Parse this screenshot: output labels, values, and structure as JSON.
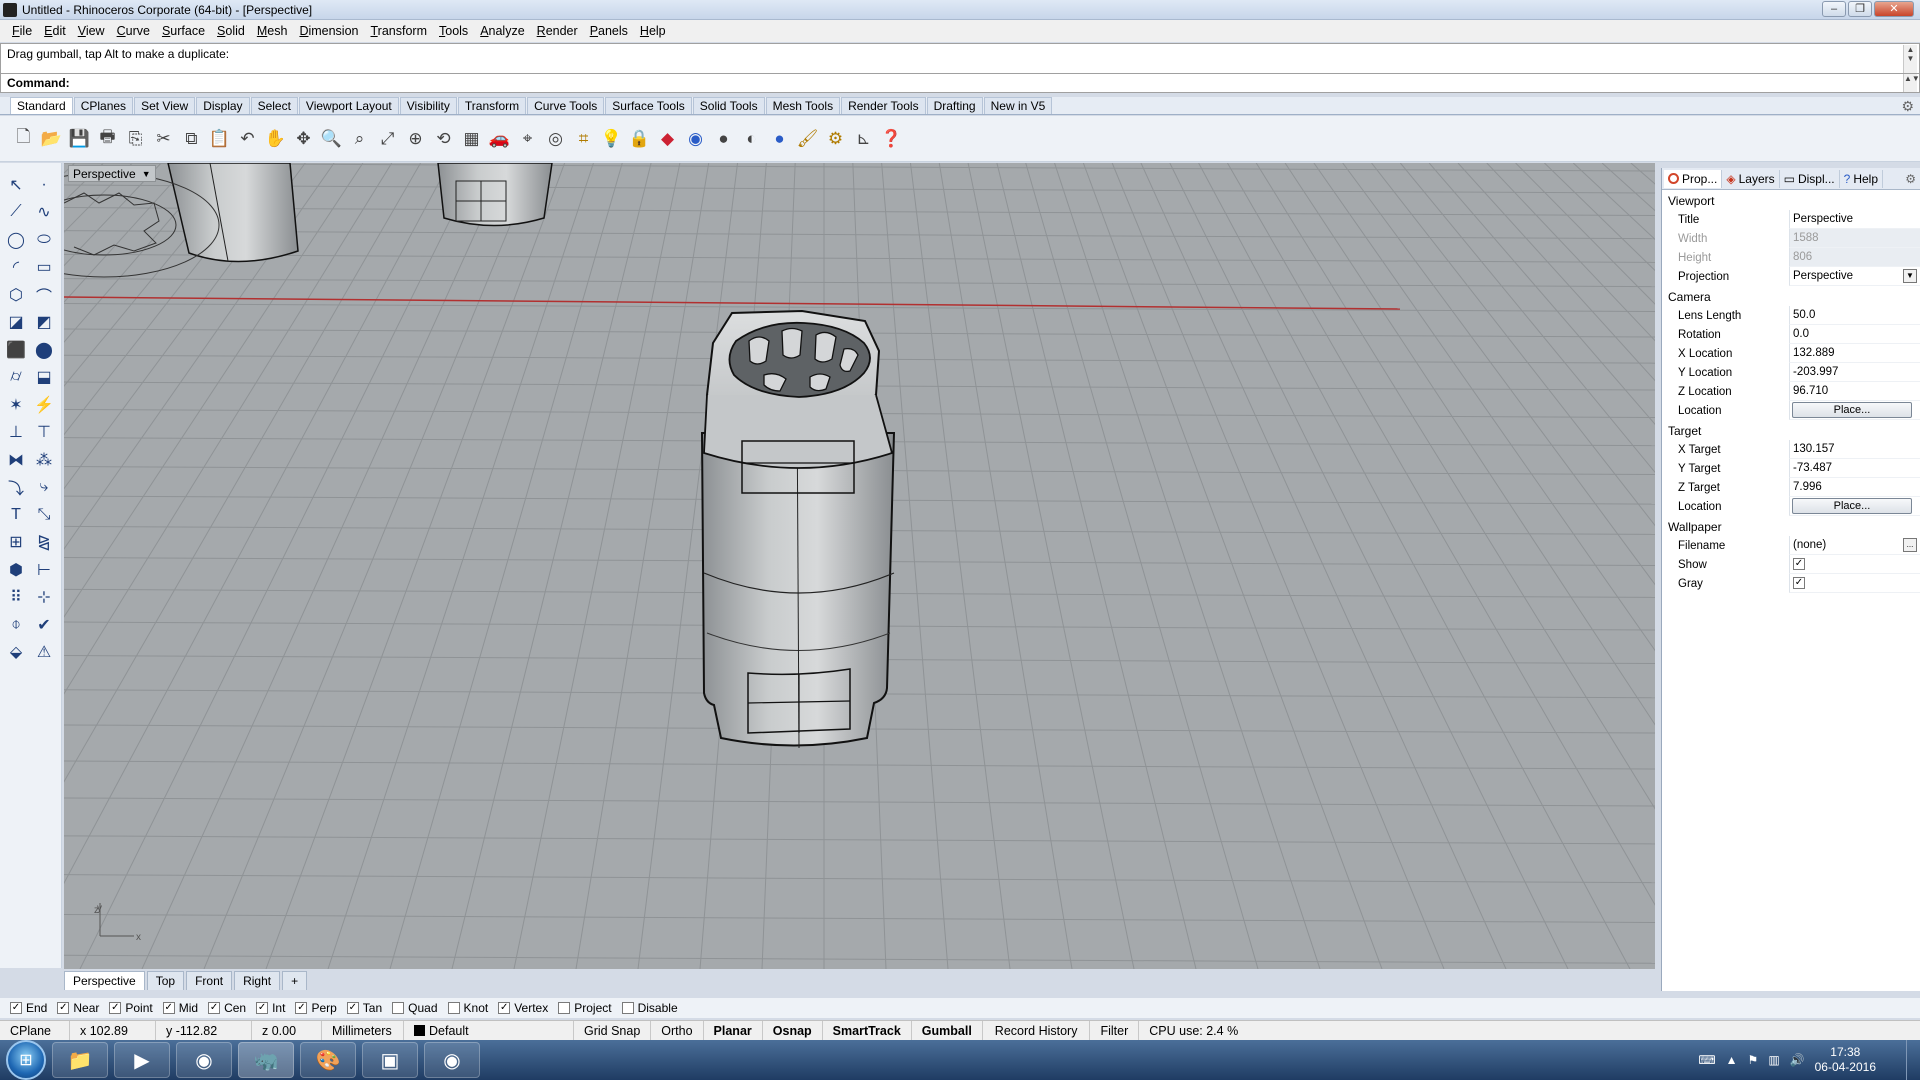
{
  "window": {
    "title": "Untitled - Rhinoceros Corporate (64-bit) - [Perspective]"
  },
  "menu": [
    "File",
    "Edit",
    "View",
    "Curve",
    "Surface",
    "Solid",
    "Mesh",
    "Dimension",
    "Transform",
    "Tools",
    "Analyze",
    "Render",
    "Panels",
    "Help"
  ],
  "command": {
    "history": "Drag gumball, tap Alt to make a duplicate:",
    "prompt": "Command:"
  },
  "toolbar_tabs": [
    "Standard",
    "CPlanes",
    "Set View",
    "Display",
    "Select",
    "Viewport Layout",
    "Visibility",
    "Transform",
    "Curve Tools",
    "Surface Tools",
    "Solid Tools",
    "Mesh Tools",
    "Render Tools",
    "Drafting",
    "New in V5"
  ],
  "toolbar_icons": [
    "new-icon",
    "open-icon",
    "save-icon",
    "print-icon",
    "import-icon",
    "cut-icon",
    "copy-icon",
    "paste-icon",
    "undo-icon",
    "pan-icon",
    "rotate-view-icon",
    "zoom-icon",
    "zoom-window-icon",
    "zoom-extents-icon",
    "zoom-selected-icon",
    "undo-view-icon",
    "grid-icon",
    "car-icon",
    "cplane-icon",
    "circle-icon",
    "osnap-icon",
    "light-icon",
    "lock-icon",
    "material-icon",
    "color-wheel-icon",
    "sphere-shaded-icon",
    "sphere-rendered-icon",
    "sphere-blue-icon",
    "paint-icon",
    "settings-icon",
    "dimension-icon",
    "help-icon"
  ],
  "viewport": {
    "title": "Perspective",
    "tabs": [
      "Perspective",
      "Top",
      "Front",
      "Right"
    ],
    "axis_x": "x",
    "axis_y": "y",
    "axis_z": "z"
  },
  "panel": {
    "tabs": [
      "Prop...",
      "Layers",
      "Displ...",
      "Help"
    ],
    "viewport": {
      "label": "Viewport",
      "title_k": "Title",
      "title_v": "Perspective",
      "width_k": "Width",
      "width_v": "1588",
      "height_k": "Height",
      "height_v": "806",
      "projection_k": "Projection",
      "projection_v": "Perspective"
    },
    "camera": {
      "label": "Camera",
      "lens_k": "Lens Length",
      "lens_v": "50.0",
      "rotation_k": "Rotation",
      "rotation_v": "0.0",
      "x_k": "X Location",
      "x_v": "132.889",
      "y_k": "Y Location",
      "y_v": "-203.997",
      "z_k": "Z Location",
      "z_v": "96.710",
      "loc_k": "Location",
      "loc_btn": "Place..."
    },
    "target": {
      "label": "Target",
      "x_k": "X Target",
      "x_v": "130.157",
      "y_k": "Y Target",
      "y_v": "-73.487",
      "z_k": "Z Target",
      "z_v": "7.996",
      "loc_k": "Location",
      "loc_btn": "Place..."
    },
    "wallpaper": {
      "label": "Wallpaper",
      "file_k": "Filename",
      "file_v": "(none)",
      "file_btn": "...",
      "show_k": "Show",
      "gray_k": "Gray"
    }
  },
  "osnaps": [
    {
      "label": "End",
      "checked": true
    },
    {
      "label": "Near",
      "checked": true
    },
    {
      "label": "Point",
      "checked": true
    },
    {
      "label": "Mid",
      "checked": true
    },
    {
      "label": "Cen",
      "checked": true
    },
    {
      "label": "Int",
      "checked": true
    },
    {
      "label": "Perp",
      "checked": true
    },
    {
      "label": "Tan",
      "checked": true
    },
    {
      "label": "Quad",
      "checked": false
    },
    {
      "label": "Knot",
      "checked": false
    },
    {
      "label": "Vertex",
      "checked": true
    },
    {
      "label": "Project",
      "checked": false
    },
    {
      "label": "Disable",
      "checked": false
    }
  ],
  "status": {
    "cplane": "CPlane",
    "x": "x 102.89",
    "y": "y -112.82",
    "z": "z 0.00",
    "units": "Millimeters",
    "layer": "Default",
    "grid_snap": "Grid Snap",
    "ortho": "Ortho",
    "planar": "Planar",
    "osnap": "Osnap",
    "smarttrack": "SmartTrack",
    "gumball": "Gumball",
    "record_history": "Record History",
    "filter": "Filter",
    "cpu": "CPU use: 2.4 %"
  },
  "taskbar": {
    "apps": [
      "explorer-icon",
      "media-player-icon",
      "chrome-icon",
      "rhino-icon",
      "paint-icon",
      "notepad-icon",
      "chrome-icon"
    ],
    "time": "17:38",
    "date": "06-04-2016"
  }
}
